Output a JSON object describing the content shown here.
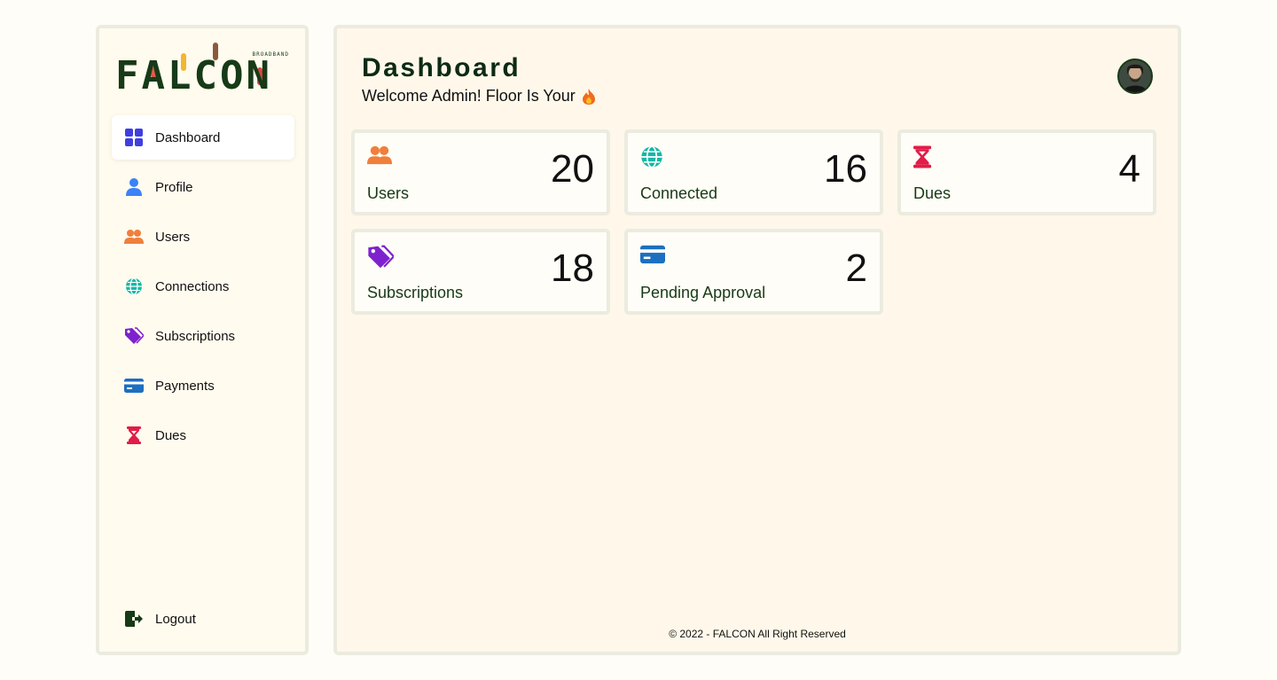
{
  "brand": {
    "name": "FALCON",
    "tagline": "BROADBAND"
  },
  "sidebar": {
    "items": [
      {
        "label": "Dashboard",
        "icon": "grid-icon",
        "active": true,
        "color": "#3f3fe0"
      },
      {
        "label": "Profile",
        "icon": "person-icon",
        "color": "#3b82f6"
      },
      {
        "label": "Users",
        "icon": "users-icon",
        "color": "#f07f3c"
      },
      {
        "label": "Connections",
        "icon": "globe-icon",
        "color": "#14b8a6"
      },
      {
        "label": "Subscriptions",
        "icon": "tags-icon",
        "color": "#7e22ce"
      },
      {
        "label": "Payments",
        "icon": "credit-card-icon",
        "color": "#1d6fc0"
      },
      {
        "label": "Dues",
        "icon": "hourglass-icon",
        "color": "#e11d48"
      }
    ],
    "logout": {
      "label": "Logout",
      "icon": "logout-icon"
    }
  },
  "header": {
    "title": "Dashboard",
    "welcome": "Welcome Admin! Floor Is Your",
    "welcome_icon": "fire-icon"
  },
  "cards": [
    {
      "label": "Users",
      "value": "20",
      "icon": "users-icon",
      "color": "#f07f3c"
    },
    {
      "label": "Connected",
      "value": "16",
      "icon": "globe-icon",
      "color": "#14b8a6"
    },
    {
      "label": "Dues",
      "value": "4",
      "icon": "hourglass-icon",
      "color": "#e11d48"
    },
    {
      "label": "Subscriptions",
      "value": "18",
      "icon": "tags-icon",
      "color": "#7e22ce"
    },
    {
      "label": "Pending Approval",
      "value": "2",
      "icon": "credit-card-icon",
      "color": "#1d6fc0"
    }
  ],
  "footer": {
    "text": "© 2022 - FALCON All Right Reserved"
  },
  "colors": {
    "brand_dark": "#173a17",
    "panel_bg": "#fff8ea",
    "border": "#ecebe0"
  }
}
